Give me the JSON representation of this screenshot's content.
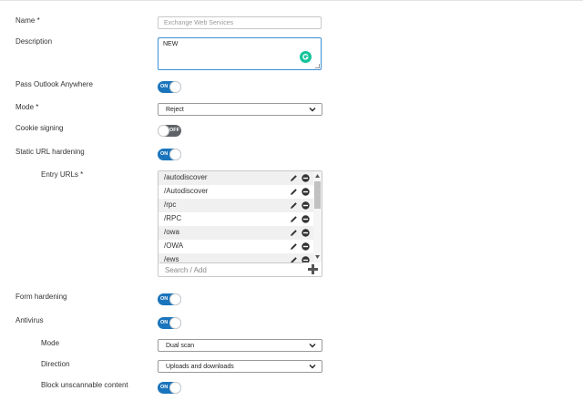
{
  "form": {
    "name": {
      "label": "Name *",
      "placeholder": "Exchange Web Services"
    },
    "description": {
      "label": "Description",
      "value": "NEW"
    },
    "pass_outlook": {
      "label": "Pass Outlook Anywhere",
      "state": "ON"
    },
    "mode": {
      "label": "Mode *",
      "selected": "Reject"
    },
    "cookie_signing": {
      "label": "Cookie signing",
      "state": "OFF"
    },
    "static_url_hardening": {
      "label": "Static URL hardening",
      "state": "ON"
    },
    "entry_urls": {
      "label": "Entry URLs *",
      "items": [
        "/autodiscover",
        "/Autodiscover",
        "/rpc",
        "/RPC",
        "/owa",
        "/OWA",
        "/ews"
      ],
      "search_placeholder": "Search / Add"
    },
    "form_hardening": {
      "label": "Form hardening",
      "state": "ON"
    },
    "antivirus": {
      "label": "Antivirus",
      "state": "ON"
    },
    "av_mode": {
      "label": "Mode",
      "selected": "Dual scan"
    },
    "direction": {
      "label": "Direction",
      "selected": "Uploads and downloads"
    },
    "block_unscannable": {
      "label": "Block unscannable content",
      "state": "ON"
    }
  },
  "colors": {
    "toggle_on": "#1b75bc",
    "toggle_off": "#5f6368",
    "focus_border": "#3a8fd6",
    "grammarly": "#15c39a"
  },
  "icons": {
    "edit": "pencil-icon",
    "delete": "minus-circle-icon",
    "add": "plus-icon",
    "dropdown": "chevron-down-icon",
    "grammarly": "grammarly-icon"
  }
}
